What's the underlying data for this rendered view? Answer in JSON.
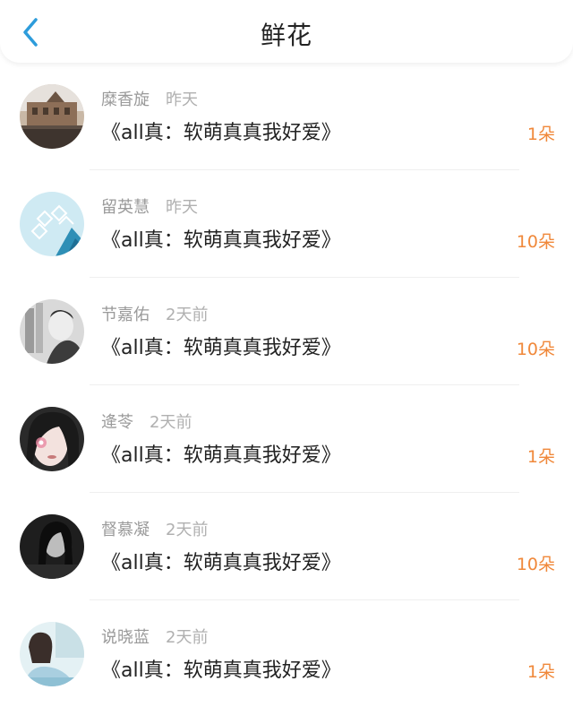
{
  "header": {
    "title": "鲜花",
    "back_icon": "chevron-left-icon",
    "accent": "#2d9cdb"
  },
  "colors": {
    "count": "#f0883a",
    "meta": "#9a9a9a"
  },
  "items": [
    {
      "name": "糜香旋",
      "time": "昨天",
      "book": "《all真：软萌真真我好爱》",
      "count": "1朵"
    },
    {
      "name": "留英慧",
      "time": "昨天",
      "book": "《all真：软萌真真我好爱》",
      "count": "10朵"
    },
    {
      "name": "节嘉佑",
      "time": "2天前",
      "book": "《all真：软萌真真我好爱》",
      "count": "10朵"
    },
    {
      "name": "逄苓",
      "time": "2天前",
      "book": "《all真：软萌真真我好爱》",
      "count": "1朵"
    },
    {
      "name": "督慕凝",
      "time": "2天前",
      "book": "《all真：软萌真真我好爱》",
      "count": "10朵"
    },
    {
      "name": "说晓蓝",
      "time": "2天前",
      "book": "《all真：软萌真真我好爱》",
      "count": "1朵"
    }
  ]
}
